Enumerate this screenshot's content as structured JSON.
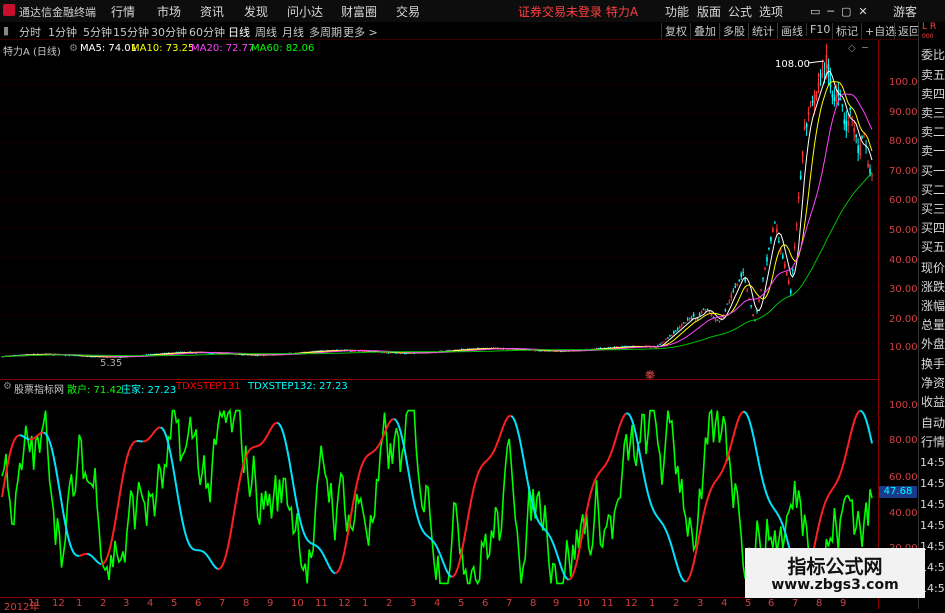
{
  "menubar": {
    "app_title": "通达信金融终端",
    "items": [
      "行情",
      "市场",
      "资讯",
      "发现",
      "问小达",
      "财富圈",
      "交易"
    ],
    "notice": "证券交易未登录  特力A",
    "right_items": [
      "功能",
      "版面",
      "公式",
      "选项"
    ],
    "user": "游客"
  },
  "periodbar": {
    "periods": [
      "分时",
      "1分钟",
      "5分钟",
      "15分钟",
      "30分钟",
      "60分钟",
      "日线",
      "周线",
      "月线",
      "多周期",
      "更多 >"
    ],
    "active": "日线",
    "tools": [
      "复权",
      "叠加",
      "多股",
      "统计",
      "画线",
      "F10",
      "标记",
      "+自选",
      "返回"
    ]
  },
  "main": {
    "stock_label": "特力A (日线)",
    "ma_legends": [
      {
        "label": "MA5: 74.01",
        "color": "#ffffff"
      },
      {
        "label": "MA10: 73.25",
        "color": "#ffff00"
      },
      {
        "label": "MA20: 72.77",
        "color": "#ff44ff"
      },
      {
        "label": "MA60: 82.06",
        "color": "#00ff00"
      }
    ],
    "high_label": "108.00",
    "low_label": "5.35",
    "marker_label": "拳",
    "y_ticks": [
      "100.0",
      "90.00",
      "80.00",
      "70.00",
      "60.00",
      "50.00",
      "40.00",
      "30.00",
      "20.00",
      "10.00"
    ]
  },
  "sub": {
    "indicator_name": "股票指标网",
    "legends": [
      {
        "label": "散户: 71.42",
        "color": "#00ff00"
      },
      {
        "label": "庄家: 27.23",
        "color": "#00ffff"
      },
      {
        "label": "TDXSTEP131",
        "color": "#ff0000"
      },
      {
        "label": "TDXSTEP132: 27.23",
        "color": "#00ffff"
      }
    ],
    "y_ticks": [
      "100.0",
      "80.00",
      "60.00",
      "40.00",
      "20.00"
    ],
    "current_value": "47.68"
  },
  "dateaxis": {
    "labels": [
      "2012年",
      "11",
      "12",
      "1",
      "2",
      "3",
      "4",
      "5",
      "6",
      "7",
      "8",
      "9",
      "10",
      "11",
      "12",
      "1",
      "2",
      "3",
      "4",
      "5",
      "6",
      "7",
      "8",
      "9",
      "10",
      "11",
      "12",
      "1",
      "2",
      "3",
      "4",
      "5",
      "6",
      "7",
      "8",
      "9"
    ]
  },
  "rightbar": {
    "items": [
      "委比",
      "卖五",
      "卖四",
      "卖三",
      "卖二",
      "卖一",
      "买一",
      "买二",
      "买三",
      "买四",
      "买五",
      "现价",
      "涨跌",
      "涨幅",
      "总量",
      "外盘",
      "换手",
      "净资",
      "收益",
      "自动",
      "行情"
    ],
    "times": [
      "14:55",
      "14:55",
      "14:55",
      "14:55",
      "14:55",
      "14:55",
      "14:55"
    ]
  },
  "watermark": {
    "line1": "指标公式网",
    "line2": "www.zbgs3.com"
  },
  "colors": {
    "up": "#ff3333",
    "down": "#00ffff",
    "retail": "#00ff00",
    "ma60": "#00c000",
    "axis": "#8a0000"
  }
}
